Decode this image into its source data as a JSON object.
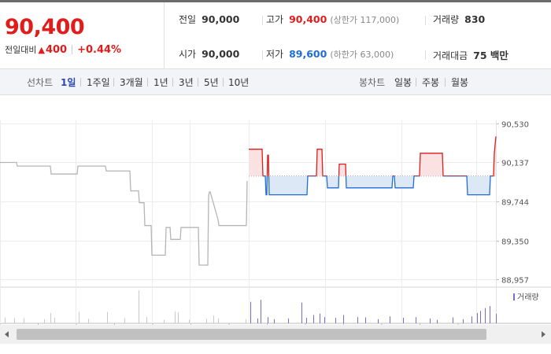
{
  "summary": {
    "price": "90,400",
    "change_label": "전일대비",
    "change_icon": "triangle-up-icon",
    "change_value": "400",
    "change_pct": "+0.44%",
    "up_color": "#e21b1b",
    "down_color": "#1f6cd8"
  },
  "stats": {
    "prev_close_label": "전일",
    "prev_close": "90,000",
    "high_label": "고가",
    "high": "90,400",
    "upper_limit": "(상한가 117,000)",
    "volume_label": "거래량",
    "volume": "830",
    "open_label": "시가",
    "open": "90,000",
    "low_label": "저가",
    "low": "89,600",
    "lower_limit": "(하한가 63,000)",
    "amount_label": "거래대금",
    "amount": "75 백만"
  },
  "tabs": {
    "line_label": "선차트",
    "line_periods": [
      "1일",
      "1주일",
      "3개월",
      "1년",
      "3년",
      "5년",
      "10년"
    ],
    "active_period": "1일",
    "candle_label": "봉차트",
    "candle_periods": [
      "일봉",
      "주봉",
      "월봉"
    ]
  },
  "chart_data": {
    "type": "line",
    "price_ticks": [
      "90,530",
      "90,137",
      "89,744",
      "89,350",
      "88,957"
    ],
    "ylim": [
      88957,
      90530
    ],
    "baseline": 90000,
    "grid": true,
    "previous_session": {
      "color": "#b5b5b5",
      "x": [
        0,
        21,
        22,
        64,
        65,
        98,
        99,
        134,
        135,
        165,
        166,
        176,
        177,
        183,
        184,
        192,
        193,
        199,
        200,
        210,
        211,
        216,
        217,
        229,
        230,
        252,
        253,
        264,
        265,
        266,
        267,
        277,
        278,
        293,
        294,
        313,
        314
      ],
      "y": [
        90137,
        90137,
        90100,
        90100,
        90020,
        90020,
        90100,
        90100,
        90050,
        90050,
        89850,
        89850,
        89730,
        89730,
        89500,
        89500,
        89200,
        89200,
        89200,
        89200,
        89480,
        89480,
        89360,
        89360,
        89480,
        89480,
        89100,
        89100,
        89800,
        89840,
        89840,
        89560,
        89500,
        89500,
        89500,
        89500,
        89950
      ]
    },
    "today": {
      "x": [
        316,
        333,
        334,
        337,
        338,
        339,
        340,
        341,
        342,
        390,
        391,
        402,
        403,
        409,
        410,
        415,
        416,
        430,
        431,
        439,
        440,
        478,
        479,
        498,
        499,
        501,
        502,
        525,
        526,
        533,
        534,
        562,
        563,
        593,
        594,
        622,
        623,
        627,
        628,
        630
      ],
      "y": [
        90270,
        90270,
        90000,
        90000,
        89810,
        89810,
        90210,
        90210,
        89810,
        89810,
        90000,
        90000,
        90270,
        90270,
        90000,
        90000,
        89880,
        89880,
        90120,
        90120,
        89880,
        89880,
        89880,
        89880,
        90000,
        90000,
        89880,
        89880,
        90000,
        90000,
        90230,
        90230,
        90000,
        90000,
        89810,
        89810,
        90000,
        90000,
        90230,
        90400
      ]
    },
    "volume_label": "거래량",
    "volume_color": "#7b6bd0",
    "volume_bars": [
      [
        6,
        0.17
      ],
      [
        18,
        0.15
      ],
      [
        30,
        0.15
      ],
      [
        56,
        0.12
      ],
      [
        64,
        0.3
      ],
      [
        69,
        0.16
      ],
      [
        100,
        0.33
      ],
      [
        112,
        0.13
      ],
      [
        136,
        0.33
      ],
      [
        158,
        0.15
      ],
      [
        176,
        0.95
      ],
      [
        186,
        0.18
      ],
      [
        208,
        0.1
      ],
      [
        222,
        0.34
      ],
      [
        226,
        0.32
      ],
      [
        240,
        0.1
      ],
      [
        262,
        0.13
      ],
      [
        271,
        0.22
      ],
      [
        277,
        0.14
      ],
      [
        312,
        0.12
      ],
      [
        318,
        0.62
      ],
      [
        327,
        0.14
      ],
      [
        331,
        0.68
      ],
      [
        340,
        0.18
      ],
      [
        348,
        0.12
      ],
      [
        366,
        0.14
      ],
      [
        383,
        0.6
      ],
      [
        389,
        0.16
      ],
      [
        398,
        0.24
      ],
      [
        406,
        0.28
      ],
      [
        412,
        0.18
      ],
      [
        426,
        0.16
      ],
      [
        436,
        0.24
      ],
      [
        454,
        0.18
      ],
      [
        464,
        0.17
      ],
      [
        480,
        0.12
      ],
      [
        495,
        0.2
      ],
      [
        512,
        0.16
      ],
      [
        528,
        0.18
      ],
      [
        546,
        0.14
      ],
      [
        555,
        0.1
      ],
      [
        575,
        0.17
      ],
      [
        588,
        0.12
      ],
      [
        599,
        0.2
      ],
      [
        606,
        0.3
      ],
      [
        610,
        0.36
      ],
      [
        616,
        0.44
      ],
      [
        622,
        0.5
      ],
      [
        630,
        0.28
      ]
    ]
  }
}
